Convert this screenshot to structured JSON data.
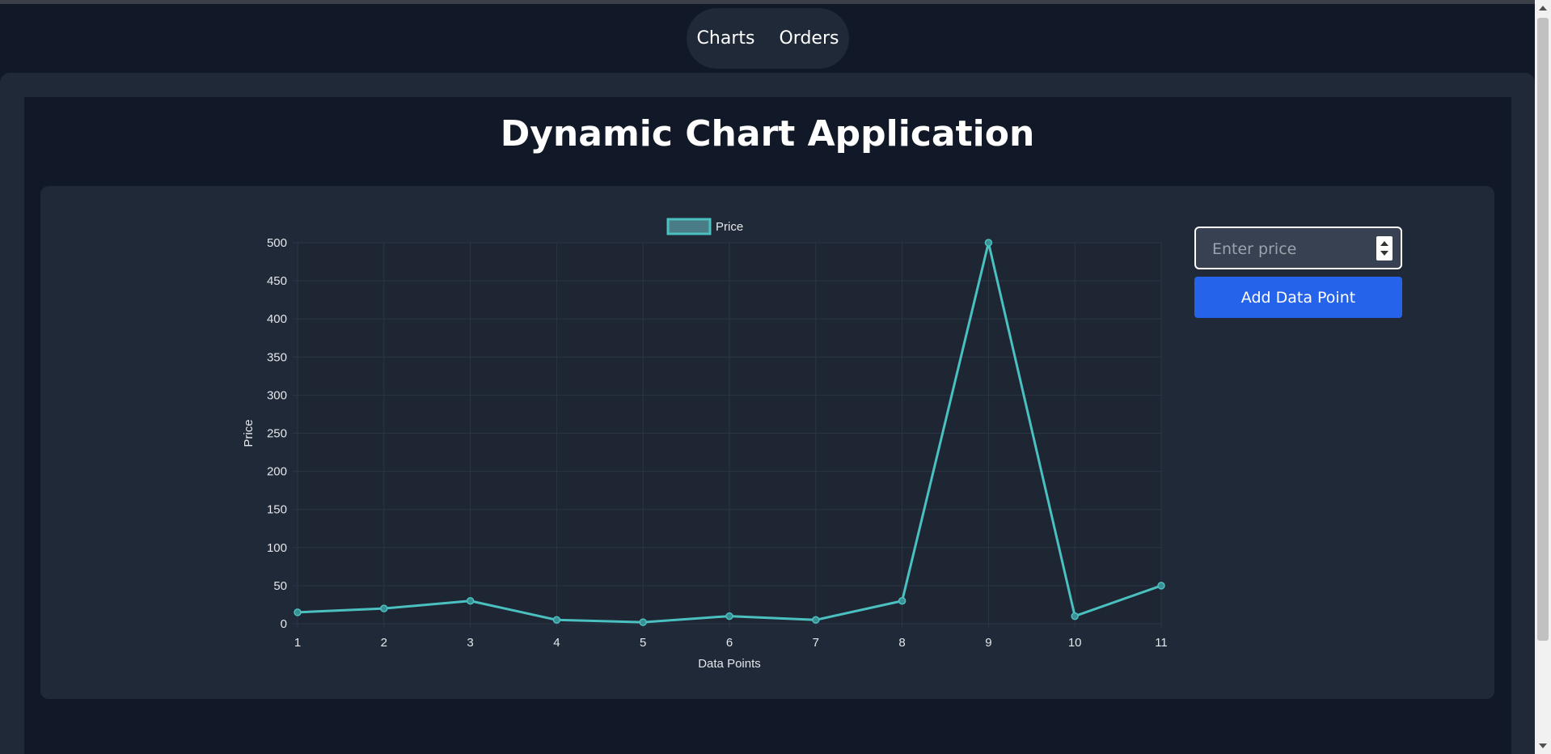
{
  "nav": {
    "items": [
      "Charts",
      "Orders"
    ]
  },
  "page": {
    "title": "Dynamic Chart Application"
  },
  "form": {
    "price_placeholder": "Enter price",
    "price_value": "",
    "add_label": "Add Data Point"
  },
  "colors": {
    "background": "#111827",
    "card": "#1f2937",
    "accent_line": "#4bc0c0",
    "button": "#2563eb"
  },
  "chart_data": {
    "type": "line",
    "x": [
      "1",
      "2",
      "3",
      "4",
      "5",
      "6",
      "7",
      "8",
      "9",
      "10",
      "11"
    ],
    "series": [
      {
        "name": "Price",
        "values": [
          15,
          20,
          30,
          5,
          2,
          10,
          5,
          30,
          500,
          10,
          50
        ]
      }
    ],
    "xlabel": "Data Points",
    "ylabel": "Price",
    "ylim": [
      0,
      500
    ],
    "yticks": [
      0,
      50,
      100,
      150,
      200,
      250,
      300,
      350,
      400,
      450,
      500
    ],
    "grid": true,
    "legend": "top-center"
  }
}
